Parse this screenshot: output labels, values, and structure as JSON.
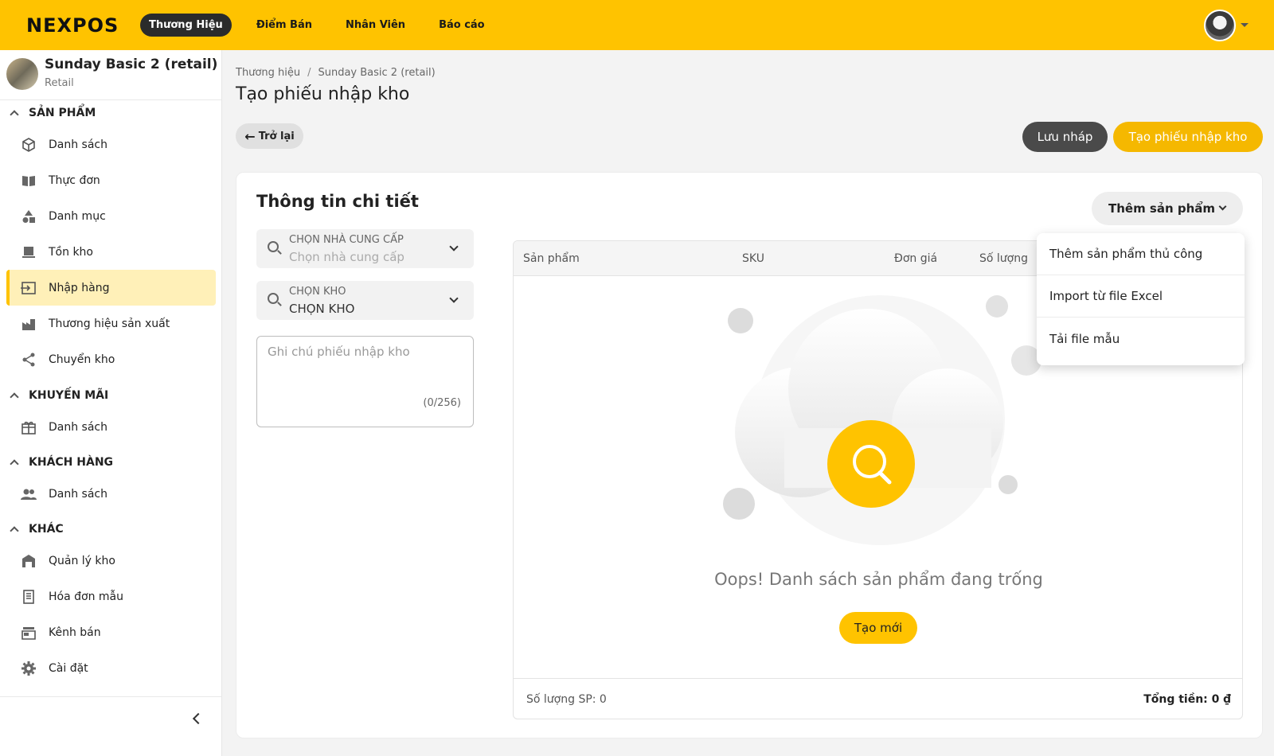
{
  "topbar": {
    "logo": "NEXPOS",
    "nav": [
      {
        "label": "Thương Hiệu",
        "active": true
      },
      {
        "label": "Điểm Bán",
        "active": false
      },
      {
        "label": "Nhân Viên",
        "active": false
      },
      {
        "label": "Báo cáo",
        "active": false
      }
    ]
  },
  "store": {
    "name": "Sunday Basic 2 (retail)",
    "type": "Retail"
  },
  "sidebar": {
    "sections": [
      {
        "title": "SẢN PHẨM",
        "items": [
          {
            "label": "Danh sách",
            "icon": "box-icon"
          },
          {
            "label": "Thực đơn",
            "icon": "menu-book-icon"
          },
          {
            "label": "Danh mục",
            "icon": "category-icon"
          },
          {
            "label": "Tồn kho",
            "icon": "inventory-icon"
          },
          {
            "label": "Nhập hàng",
            "icon": "import-icon",
            "active": true
          },
          {
            "label": "Thương hiệu sản xuất",
            "icon": "factory-icon"
          },
          {
            "label": "Chuyển kho",
            "icon": "share-icon"
          }
        ]
      },
      {
        "title": "KHUYẾN MÃI",
        "items": [
          {
            "label": "Danh sách",
            "icon": "gift-icon"
          }
        ]
      },
      {
        "title": "KHÁCH HÀNG",
        "items": [
          {
            "label": "Danh sách",
            "icon": "people-icon"
          }
        ]
      },
      {
        "title": "KHÁC",
        "items": [
          {
            "label": "Quản lý kho",
            "icon": "warehouse-icon"
          },
          {
            "label": "Hóa đơn mẫu",
            "icon": "receipt-icon"
          },
          {
            "label": "Kênh bán",
            "icon": "store-icon"
          },
          {
            "label": "Cài đặt",
            "icon": "gear-icon"
          }
        ]
      }
    ]
  },
  "breadcrumb": [
    "Thương hiệu",
    "Sunday Basic 2 (retail)"
  ],
  "page_title": "Tạo phiếu nhập kho",
  "actions": {
    "back": "Trở lại",
    "draft": "Lưu nháp",
    "create": "Tạo phiếu nhập kho"
  },
  "details": {
    "title": "Thông tin chi tiết",
    "supplier": {
      "label": "CHỌN NHÀ CUNG CẤP",
      "placeholder": "Chọn nhà cung cấp"
    },
    "warehouse": {
      "label": "CHỌN KHO",
      "value": "CHỌN KHO"
    },
    "note": {
      "placeholder": "Ghi chú phiếu nhập kho",
      "counter": "(0/256)"
    }
  },
  "add_product": {
    "label": "Thêm sản phẩm",
    "menu": [
      "Thêm sản phẩm thủ công",
      "Import từ file Excel",
      "Tải file mẫu"
    ]
  },
  "table": {
    "columns": [
      "Sản phẩm",
      "SKU",
      "Đơn giá",
      "Số lượng"
    ],
    "empty_message": "Oops! Danh sách sản phẩm đang trống",
    "new_button": "Tạo mới",
    "footer_count": "Số lượng SP: 0",
    "footer_total": "Tổng tiền: 0 ₫"
  },
  "colors": {
    "accent": "#ffc300",
    "dark": "#2b2b2b"
  }
}
